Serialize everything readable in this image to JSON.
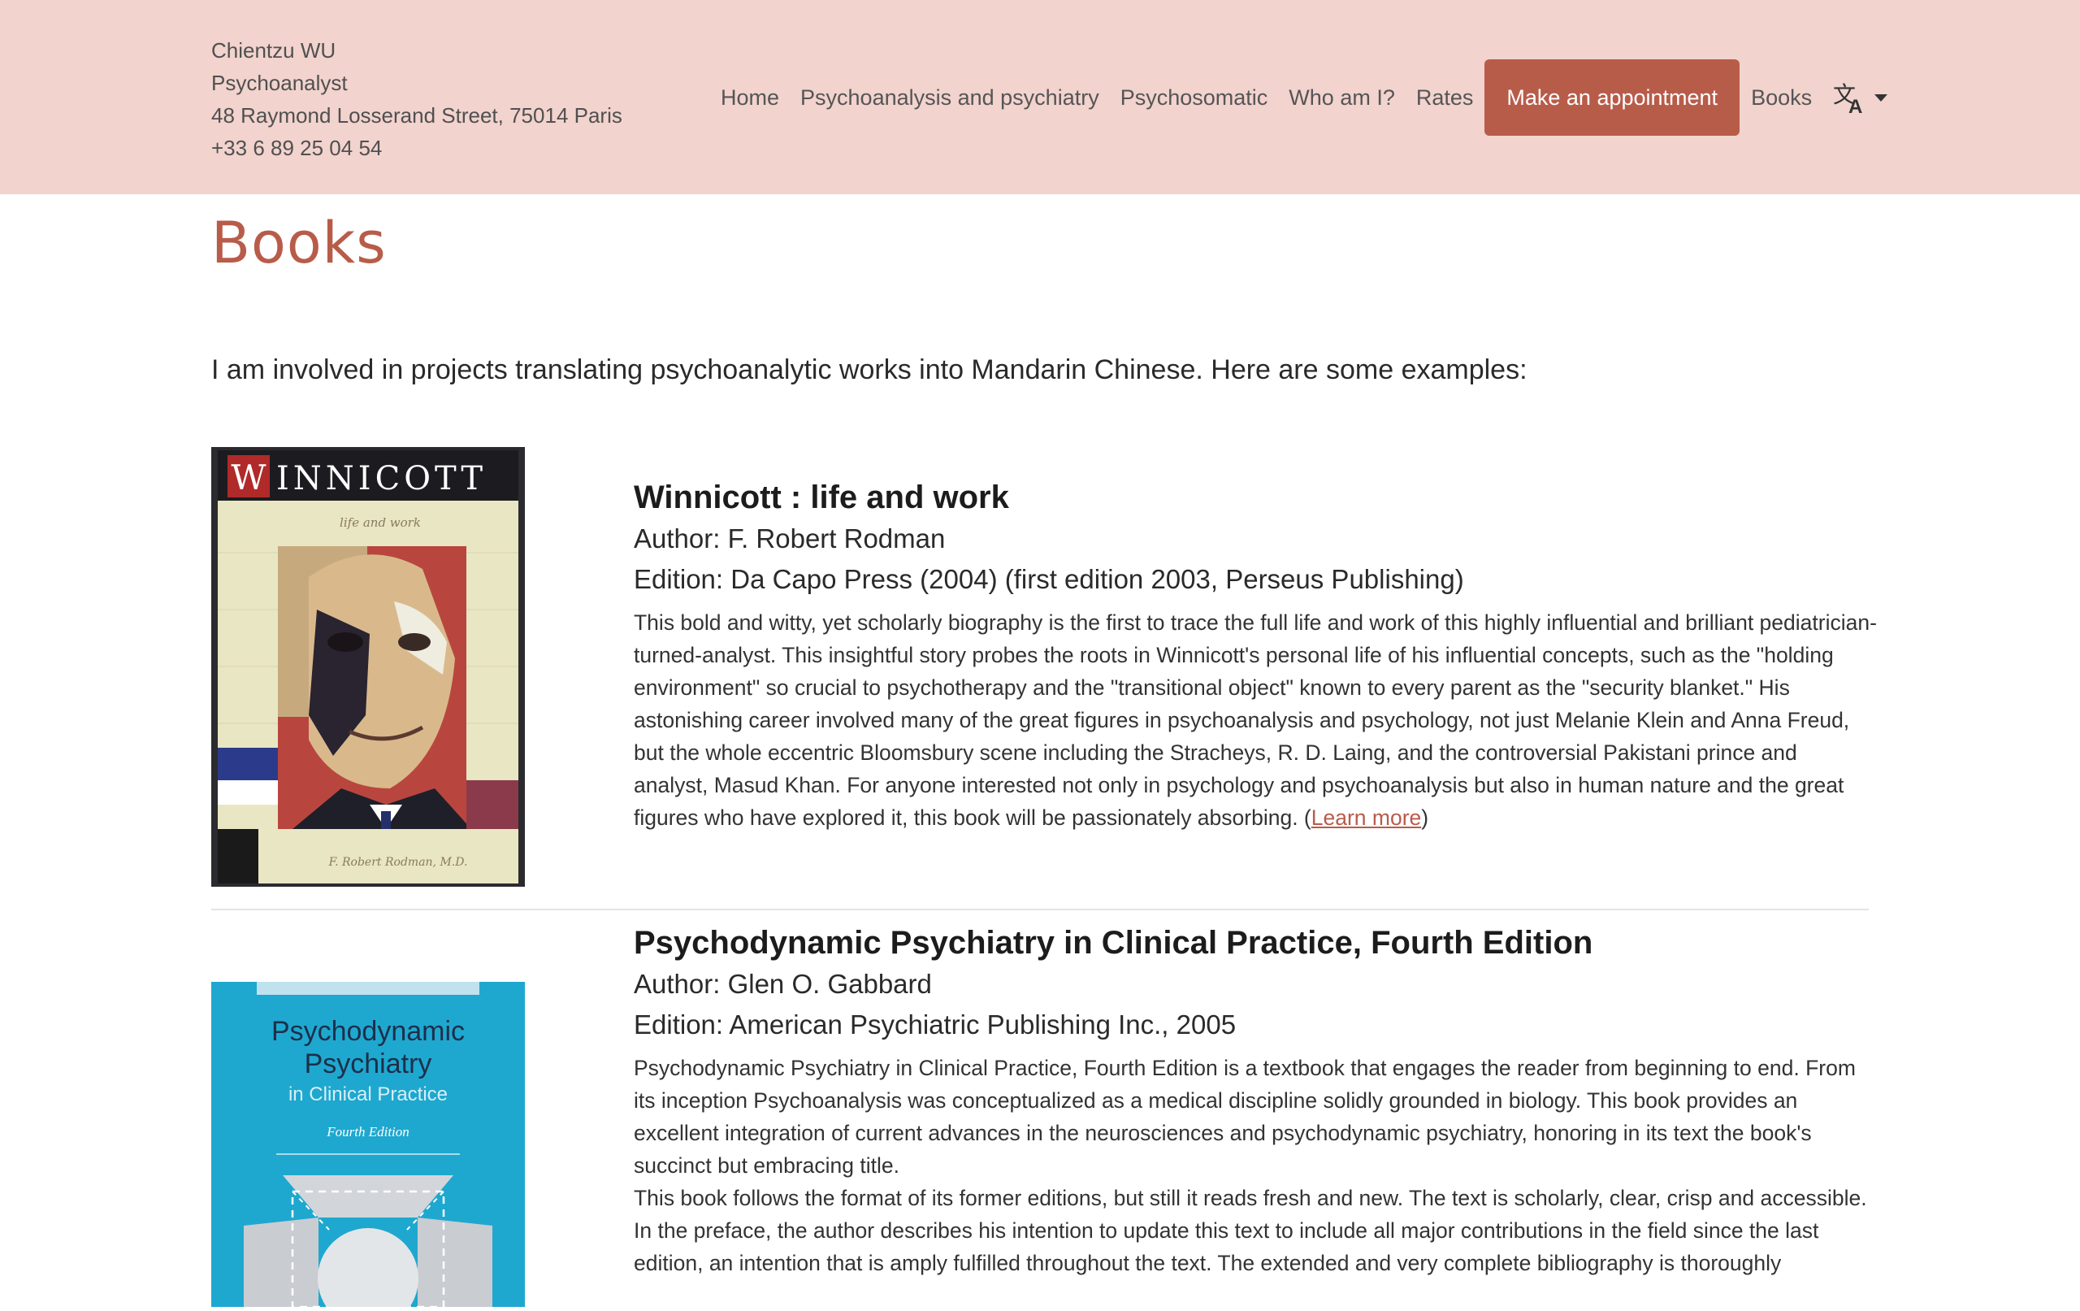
{
  "header": {
    "contact": {
      "name": "Chientzu WU",
      "role": "Psychoanalyst",
      "address": "48 Raymond Losserand Street, 75014 Paris",
      "phone": "+33 6 89 25 04 54"
    },
    "nav": {
      "home": "Home",
      "psychoanalysis": "Psychoanalysis and psychiatry",
      "psychosomatic": "Psychosomatic",
      "who": "Who am I?",
      "rates": "Rates",
      "appointment": "Make an appointment",
      "books": "Books"
    },
    "language_icon": "translate-icon"
  },
  "main": {
    "title": "Books",
    "intro": "I am involved in projects translating psychoanalytic works into Mandarin Chinese. Here are some examples:",
    "books": [
      {
        "title": "Winnicott : life and work",
        "author": "Author: F. Robert Rodman",
        "edition": "Edition: Da Capo Press (2004) (first edition 2003, Perseus Publishing)",
        "description": "This bold and witty, yet scholarly biography is the first to trace the full life and work of this highly influential and brilliant pediatrician-turned-analyst. This insightful story probes the roots in Winnicott's personal life of his influential concepts, such as the \"holding environment\" so crucial to psychotherapy and the \"transitional object\" known to every parent as the \"security blanket.\" His astonishing career involved many of the great figures in psychoanalysis and psychology, not just Melanie Klein and Anna Freud, but the whole eccentric Bloomsbury scene including the Stracheys, R. D. Laing, and the controversial Pakistani prince and analyst, Masud Khan. For anyone interested not only in psychology and psychoanalysis but also in human nature and the great figures who have explored it, this book will be passionately absorbing. (",
        "link": "Learn more",
        "after_link": ")",
        "cover": {
          "title_first": "W",
          "title_rest": "INNICOTT",
          "subtitle": "life and work",
          "author": "F. Robert Rodman, M.D."
        }
      },
      {
        "title": "Psychodynamic Psychiatry in Clinical Practice, Fourth Edition",
        "author": "Author: Glen O. Gabbard",
        "edition": "Edition: American Psychiatric Publishing Inc., 2005",
        "description_1": "Psychodynamic Psychiatry in Clinical Practice, Fourth Edition is a textbook that engages the reader from beginning to end. From its inception Psychoanalysis was conceptualized as a medical discipline solidly grounded in biology. This book provides an excellent integration of current advances in the neurosciences and psychodynamic psychiatry, honoring in its text the book's succinct but embracing title.",
        "description_2": "This book follows the format of its former editions, but still it reads fresh and new. The text is scholarly, clear, crisp and accessible. In the preface, the author describes his intention to update this text to include all major contributions in the field since the last edition, an intention that is amply fulfilled throughout the text. The extended and very complete bibliography is thoroughly",
        "cover": {
          "line1": "Psychodynamic",
          "line2": "Psychiatry",
          "line3": "in Clinical Practice",
          "line4": "Fourth Edition"
        }
      }
    ]
  },
  "colors": {
    "header_bg": "#f2d3ce",
    "accent": "#b85c4a",
    "cover2_bg": "#1ea8cf"
  }
}
